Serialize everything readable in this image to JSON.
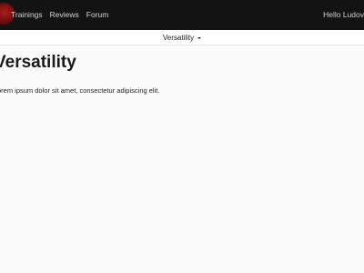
{
  "navbar": {
    "links": [
      "Trainings",
      "Reviews",
      "Forum"
    ],
    "greeting": "Hello Ludov",
    "colors": {
      "background": "#131313",
      "logo": "#8c1414"
    }
  },
  "subnav": {
    "dropdown_label": "Versatility"
  },
  "main": {
    "title": "Versatility",
    "text": "orem ipsum dolor sit amet, consectetur adipiscing elit."
  }
}
